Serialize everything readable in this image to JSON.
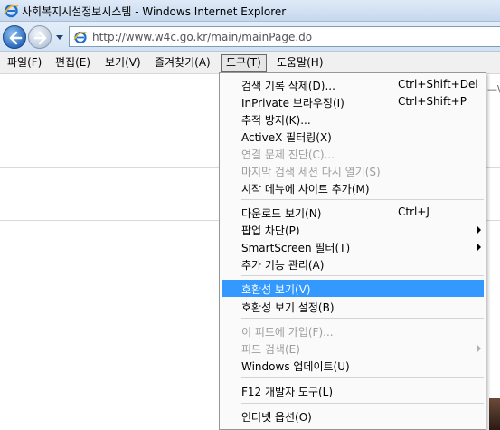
{
  "window": {
    "title": "사회복지시설정보시스템 - Windows Internet Explorer"
  },
  "navigation": {
    "address_url": "http://www.w4c.go.kr/main/mainPage.do"
  },
  "menubar": {
    "items": [
      {
        "label": "파일(F)"
      },
      {
        "label": "편집(E)"
      },
      {
        "label": "보기(V)"
      },
      {
        "label": "즐겨찾기(A)"
      },
      {
        "label": "도구(T)"
      },
      {
        "label": "도움말(H)"
      }
    ]
  },
  "page": {
    "fragment_right": "—\\"
  },
  "tools_menu": {
    "items": [
      {
        "label": "검색 기록 삭제(D)...",
        "shortcut": "Ctrl+Shift+Del"
      },
      {
        "label": "InPrivate 브라우징(I)",
        "shortcut": "Ctrl+Shift+P"
      },
      {
        "label": "추적 방지(K)..."
      },
      {
        "label": "ActiveX 필터링(X)"
      },
      {
        "label": "연결 문제 진단(C)..."
      },
      {
        "label": "마지막 검색 세션 다시 열기(S)"
      },
      {
        "label": "시작 메뉴에 사이트 추가(M)"
      },
      {
        "label": "다운로드 보기(N)",
        "shortcut": "Ctrl+J"
      },
      {
        "label": "팝업 차단(P)"
      },
      {
        "label": "SmartScreen 필터(T)"
      },
      {
        "label": "추가 기능 관리(A)"
      },
      {
        "label": "호환성 보기(V)"
      },
      {
        "label": "호환성 보기 설정(B)"
      },
      {
        "label": "이 피드에 가입(F)..."
      },
      {
        "label": "피드 검색(E)"
      },
      {
        "label": "Windows 업데이트(U)"
      },
      {
        "label": "F12 개발자 도구(L)"
      },
      {
        "label": "인터넷 옵션(O)"
      }
    ]
  },
  "colors": {
    "highlight": "#3399ff",
    "disabled_text": "#9d9d9d"
  }
}
